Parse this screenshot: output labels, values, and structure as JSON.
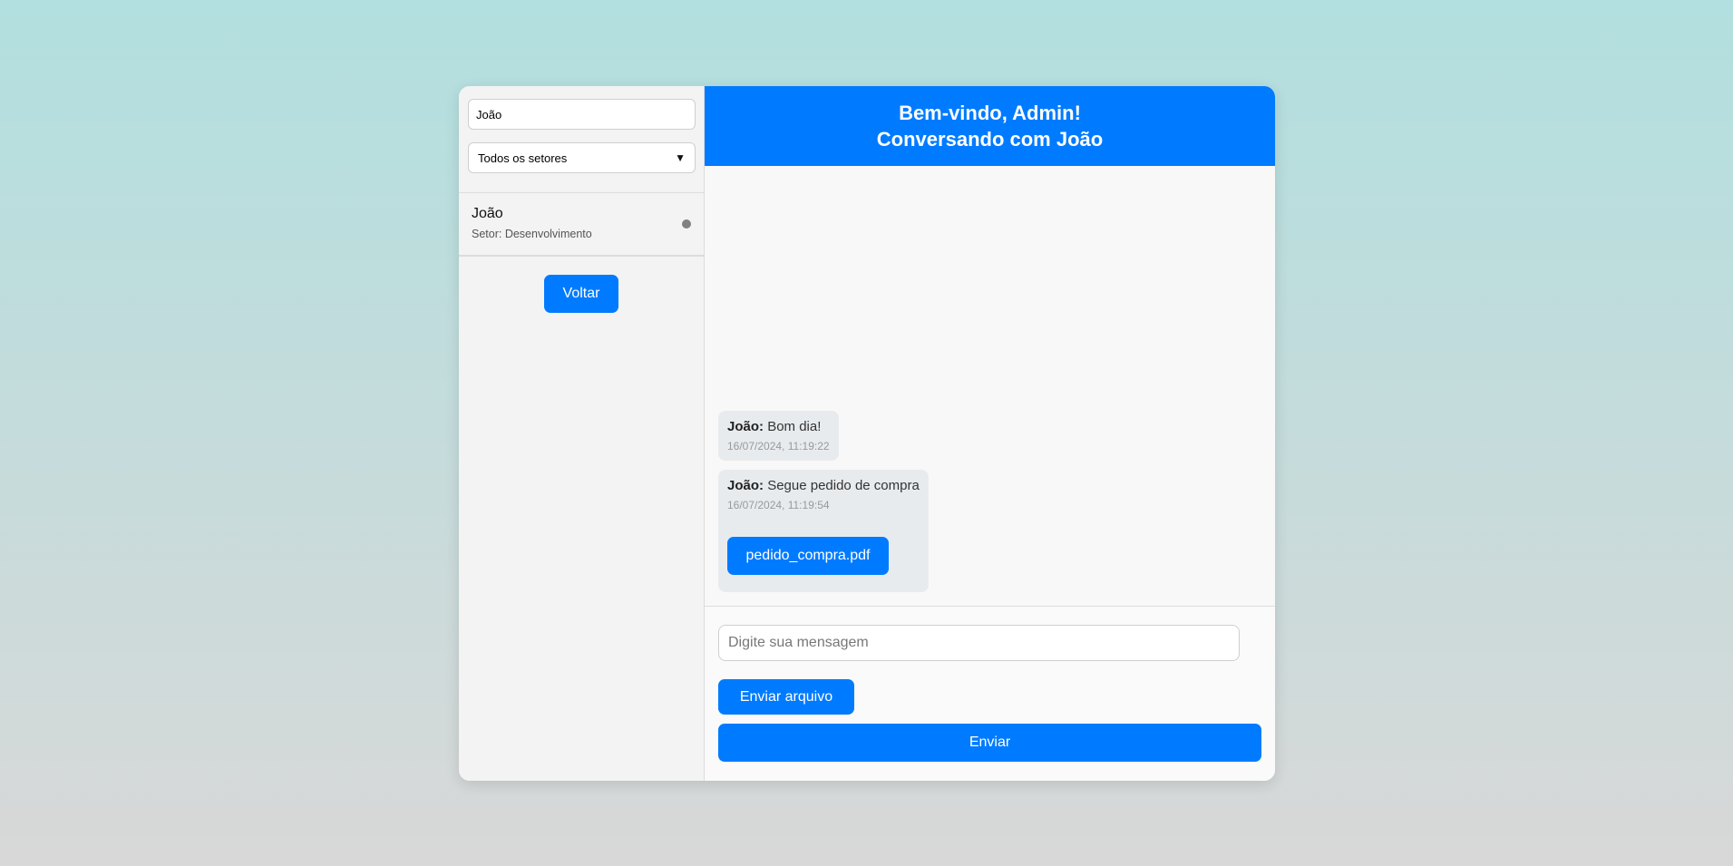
{
  "sidebar": {
    "search_value": "João",
    "sector_select": {
      "selected": "Todos os setores"
    },
    "users": [
      {
        "name": "João",
        "sector": "Setor: Desenvolvimento",
        "status": "offline"
      }
    ],
    "back_label": "Voltar"
  },
  "chat": {
    "welcome": "Bem-vindo, Admin!",
    "talking_with": "Conversando com João",
    "messages": [
      {
        "sender": "João:",
        "text": "Bom dia!",
        "time": "16/07/2024, 11:19:22"
      },
      {
        "sender": "João:",
        "text": "Segue pedido de compra",
        "time": "16/07/2024, 11:19:54",
        "file": "pedido_compra.pdf"
      }
    ],
    "input_placeholder": "Digite sua mensagem",
    "attach_label": "Enviar arquivo",
    "send_label": "Enviar"
  },
  "colors": {
    "accent": "#007bff",
    "status_offline": "#808080"
  }
}
